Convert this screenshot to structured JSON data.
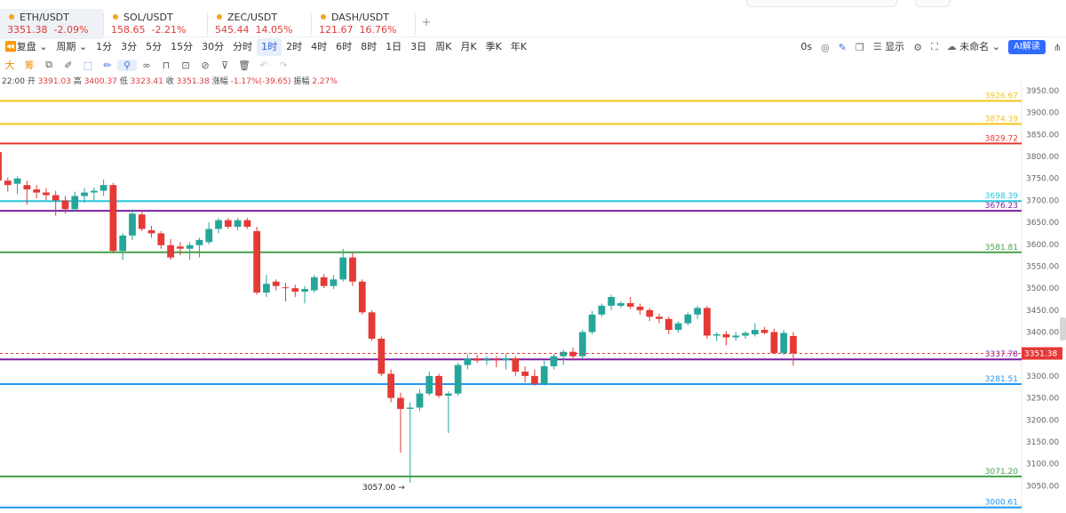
{
  "tabs": [
    {
      "symbol": "ETH/USDT",
      "price": "3351.38",
      "change": "-2.09%",
      "active": true
    },
    {
      "symbol": "SOL/USDT",
      "price": "158.65",
      "change": "-2.21%",
      "active": false
    },
    {
      "symbol": "ZEC/USDT",
      "price": "545.44",
      "change": "14.05%",
      "active": false
    },
    {
      "symbol": "DASH/USDT",
      "price": "121.67",
      "change": "16.76%",
      "active": false
    }
  ],
  "add_tab": "+",
  "toolbar": {
    "replay": "复盘",
    "period_label": "周期",
    "intervals": [
      "1分",
      "3分",
      "5分",
      "15分",
      "30分",
      "分时",
      "1时",
      "2时",
      "4时",
      "6时",
      "8时",
      "1日",
      "3日",
      "周K",
      "月K",
      "季K",
      "年K"
    ],
    "selected_interval": "1时",
    "countdown": "0s",
    "display_label": "显示",
    "layout_name": "未命名",
    "ai_button": "AI解读"
  },
  "drawbar": {
    "big": "大",
    "chip": "筹"
  },
  "ohlc": {
    "time": "22:00",
    "open_label": "开",
    "open": "3391.03",
    "high_label": "高",
    "high": "3400.37",
    "low_label": "低",
    "low": "3323.41",
    "close_label": "收",
    "close": "3351.38",
    "change_label": "涨幅",
    "change": "-1.17%(-39.65)",
    "amp_label": "振幅",
    "amp": "2.27%"
  },
  "chart_data": {
    "type": "candlestick",
    "symbol": "ETH/USDT",
    "interval": "1时",
    "y_ticks": [
      3950,
      3900,
      3850,
      3800,
      3750,
      3700,
      3650,
      3600,
      3550,
      3500,
      3450,
      3400,
      3350,
      3300,
      3250,
      3200,
      3150,
      3100,
      3050
    ],
    "ylim": [
      3000,
      3950
    ],
    "last_price": "3351.38",
    "min_marker": "3057.00 →",
    "horizontal_lines": [
      {
        "price": 3926.67,
        "label": "3926.67",
        "color": "#f5c518"
      },
      {
        "price": 3874.39,
        "label": "3874.39",
        "color": "#f5c518"
      },
      {
        "price": 3829.72,
        "label": "3829.72",
        "color": "#e53935"
      },
      {
        "price": 3698.39,
        "label": "3698.39",
        "color": "#26c6da"
      },
      {
        "price": 3676.23,
        "label": "3676.23",
        "color": "#7b1fa2"
      },
      {
        "price": 3581.81,
        "label": "3581.81",
        "color": "#43a047"
      },
      {
        "price": 3337.78,
        "label": "3337.78",
        "color": "#7b1fa2"
      },
      {
        "price": 3281.51,
        "label": "3281.51",
        "color": "#2196f3"
      },
      {
        "price": 3071.2,
        "label": "3071.20",
        "color": "#43a047"
      },
      {
        "price": 3000.61,
        "label": "3000.61",
        "color": "#2196f3"
      }
    ],
    "candles": [
      {
        "o": 3810,
        "h": 3815,
        "l": 3740,
        "c": 3745
      },
      {
        "o": 3745,
        "h": 3752,
        "l": 3720,
        "c": 3735
      },
      {
        "o": 3738,
        "h": 3755,
        "l": 3715,
        "c": 3750
      },
      {
        "o": 3735,
        "h": 3745,
        "l": 3690,
        "c": 3725
      },
      {
        "o": 3725,
        "h": 3735,
        "l": 3705,
        "c": 3718
      },
      {
        "o": 3718,
        "h": 3728,
        "l": 3700,
        "c": 3712
      },
      {
        "o": 3712,
        "h": 3722,
        "l": 3665,
        "c": 3700
      },
      {
        "o": 3700,
        "h": 3710,
        "l": 3670,
        "c": 3680
      },
      {
        "o": 3680,
        "h": 3720,
        "l": 3675,
        "c": 3710
      },
      {
        "o": 3710,
        "h": 3728,
        "l": 3695,
        "c": 3718
      },
      {
        "o": 3718,
        "h": 3730,
        "l": 3700,
        "c": 3722
      },
      {
        "o": 3722,
        "h": 3748,
        "l": 3710,
        "c": 3735
      },
      {
        "o": 3735,
        "h": 3740,
        "l": 3580,
        "c": 3585
      },
      {
        "o": 3585,
        "h": 3625,
        "l": 3565,
        "c": 3620
      },
      {
        "o": 3620,
        "h": 3680,
        "l": 3610,
        "c": 3670
      },
      {
        "o": 3668,
        "h": 3678,
        "l": 3630,
        "c": 3635
      },
      {
        "o": 3632,
        "h": 3642,
        "l": 3615,
        "c": 3625
      },
      {
        "o": 3625,
        "h": 3630,
        "l": 3590,
        "c": 3598
      },
      {
        "o": 3598,
        "h": 3612,
        "l": 3565,
        "c": 3570
      },
      {
        "o": 3595,
        "h": 3605,
        "l": 3575,
        "c": 3590
      },
      {
        "o": 3590,
        "h": 3605,
        "l": 3565,
        "c": 3598
      },
      {
        "o": 3598,
        "h": 3615,
        "l": 3570,
        "c": 3610
      },
      {
        "o": 3605,
        "h": 3650,
        "l": 3600,
        "c": 3635
      },
      {
        "o": 3635,
        "h": 3660,
        "l": 3625,
        "c": 3655
      },
      {
        "o": 3655,
        "h": 3660,
        "l": 3635,
        "c": 3640
      },
      {
        "o": 3640,
        "h": 3660,
        "l": 3632,
        "c": 3655
      },
      {
        "o": 3655,
        "h": 3660,
        "l": 3635,
        "c": 3640
      },
      {
        "o": 3630,
        "h": 3640,
        "l": 3485,
        "c": 3490
      },
      {
        "o": 3490,
        "h": 3530,
        "l": 3480,
        "c": 3510
      },
      {
        "o": 3515,
        "h": 3520,
        "l": 3495,
        "c": 3505
      },
      {
        "o": 3502,
        "h": 3512,
        "l": 3470,
        "c": 3500
      },
      {
        "o": 3500,
        "h": 3508,
        "l": 3480,
        "c": 3492
      },
      {
        "o": 3492,
        "h": 3505,
        "l": 3465,
        "c": 3498
      },
      {
        "o": 3495,
        "h": 3530,
        "l": 3490,
        "c": 3525
      },
      {
        "o": 3525,
        "h": 3532,
        "l": 3500,
        "c": 3505
      },
      {
        "o": 3505,
        "h": 3530,
        "l": 3498,
        "c": 3520
      },
      {
        "o": 3520,
        "h": 3590,
        "l": 3515,
        "c": 3570
      },
      {
        "o": 3570,
        "h": 3580,
        "l": 3505,
        "c": 3515
      },
      {
        "o": 3515,
        "h": 3520,
        "l": 3440,
        "c": 3445
      },
      {
        "o": 3445,
        "h": 3450,
        "l": 3380,
        "c": 3385
      },
      {
        "o": 3385,
        "h": 3390,
        "l": 3300,
        "c": 3305
      },
      {
        "o": 3305,
        "h": 3315,
        "l": 3240,
        "c": 3250
      },
      {
        "o": 3250,
        "h": 3262,
        "l": 3125,
        "c": 3225
      },
      {
        "o": 3225,
        "h": 3240,
        "l": 3057,
        "c": 3228
      },
      {
        "o": 3228,
        "h": 3270,
        "l": 3220,
        "c": 3260
      },
      {
        "o": 3260,
        "h": 3310,
        "l": 3255,
        "c": 3300
      },
      {
        "o": 3300,
        "h": 3305,
        "l": 3250,
        "c": 3255
      },
      {
        "o": 3255,
        "h": 3265,
        "l": 3170,
        "c": 3260
      },
      {
        "o": 3260,
        "h": 3330,
        "l": 3255,
        "c": 3325
      },
      {
        "o": 3325,
        "h": 3350,
        "l": 3315,
        "c": 3340
      },
      {
        "o": 3340,
        "h": 3348,
        "l": 3330,
        "c": 3335
      },
      {
        "o": 3335,
        "h": 3345,
        "l": 3325,
        "c": 3338
      },
      {
        "o": 3338,
        "h": 3345,
        "l": 3320,
        "c": 3336
      },
      {
        "o": 3336,
        "h": 3350,
        "l": 3315,
        "c": 3340
      },
      {
        "o": 3340,
        "h": 3345,
        "l": 3300,
        "c": 3310
      },
      {
        "o": 3310,
        "h": 3322,
        "l": 3285,
        "c": 3300
      },
      {
        "o": 3300,
        "h": 3315,
        "l": 3278,
        "c": 3282
      },
      {
        "o": 3282,
        "h": 3335,
        "l": 3278,
        "c": 3322
      },
      {
        "o": 3322,
        "h": 3350,
        "l": 3315,
        "c": 3345
      },
      {
        "o": 3345,
        "h": 3360,
        "l": 3325,
        "c": 3355
      },
      {
        "o": 3355,
        "h": 3365,
        "l": 3335,
        "c": 3345
      },
      {
        "o": 3345,
        "h": 3405,
        "l": 3340,
        "c": 3400
      },
      {
        "o": 3400,
        "h": 3448,
        "l": 3395,
        "c": 3440
      },
      {
        "o": 3440,
        "h": 3465,
        "l": 3435,
        "c": 3460
      },
      {
        "o": 3460,
        "h": 3485,
        "l": 3450,
        "c": 3480
      },
      {
        "o": 3460,
        "h": 3470,
        "l": 3455,
        "c": 3466
      },
      {
        "o": 3466,
        "h": 3480,
        "l": 3452,
        "c": 3458
      },
      {
        "o": 3458,
        "h": 3465,
        "l": 3440,
        "c": 3450
      },
      {
        "o": 3450,
        "h": 3455,
        "l": 3425,
        "c": 3435
      },
      {
        "o": 3435,
        "h": 3442,
        "l": 3420,
        "c": 3430
      },
      {
        "o": 3430,
        "h": 3435,
        "l": 3395,
        "c": 3405
      },
      {
        "o": 3405,
        "h": 3425,
        "l": 3398,
        "c": 3420
      },
      {
        "o": 3420,
        "h": 3445,
        "l": 3415,
        "c": 3440
      },
      {
        "o": 3440,
        "h": 3460,
        "l": 3430,
        "c": 3455
      },
      {
        "o": 3455,
        "h": 3460,
        "l": 3385,
        "c": 3392
      },
      {
        "o": 3392,
        "h": 3400,
        "l": 3380,
        "c": 3395
      },
      {
        "o": 3395,
        "h": 3402,
        "l": 3370,
        "c": 3388
      },
      {
        "o": 3388,
        "h": 3400,
        "l": 3380,
        "c": 3392
      },
      {
        "o": 3392,
        "h": 3402,
        "l": 3385,
        "c": 3398
      },
      {
        "o": 3395,
        "h": 3420,
        "l": 3390,
        "c": 3405
      },
      {
        "o": 3405,
        "h": 3412,
        "l": 3395,
        "c": 3398
      },
      {
        "o": 3400,
        "h": 3408,
        "l": 3350,
        "c": 3352
      },
      {
        "o": 3352,
        "h": 3405,
        "l": 3348,
        "c": 3398
      },
      {
        "o": 3391.03,
        "h": 3400.37,
        "l": 3323.41,
        "c": 3351.38
      }
    ]
  },
  "colors": {
    "up": "#26a69a",
    "down": "#e53935",
    "accent": "#2f6bff",
    "last_price_bg": "#e53935"
  }
}
